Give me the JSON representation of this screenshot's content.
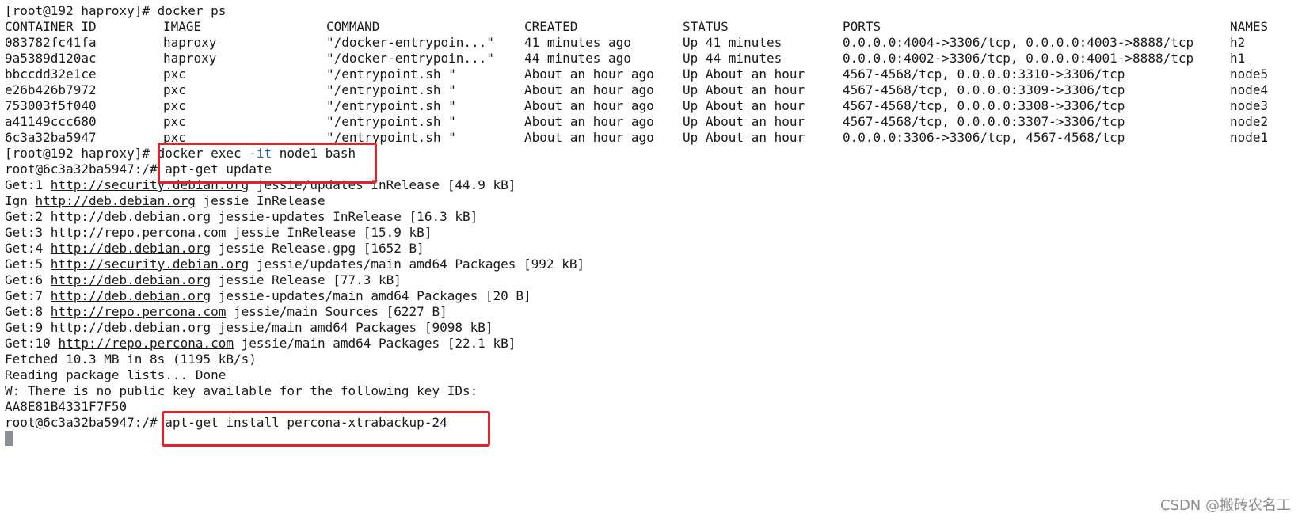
{
  "ps": {
    "prompt": "[root@192 haproxy]# ",
    "command": "docker ps",
    "headers": {
      "container_id": "CONTAINER ID",
      "image": "IMAGE",
      "command": "COMMAND",
      "created": "CREATED",
      "status": "STATUS",
      "ports": "PORTS",
      "names": "NAMES"
    },
    "rows": [
      {
        "id": "083782fc41fa",
        "image": "haproxy",
        "command": "\"/docker-entrypoin...\"",
        "created": "41 minutes ago",
        "status": "Up 41 minutes",
        "ports": "0.0.0.0:4004->3306/tcp, 0.0.0.0:4003->8888/tcp",
        "name": "h2"
      },
      {
        "id": "9a5389d120ac",
        "image": "haproxy",
        "command": "\"/docker-entrypoin...\"",
        "created": "44 minutes ago",
        "status": "Up 44 minutes",
        "ports": "0.0.0.0:4002->3306/tcp, 0.0.0.0:4001->8888/tcp",
        "name": "h1"
      },
      {
        "id": "bbccdd32e1ce",
        "image": "pxc",
        "command": "\"/entrypoint.sh \"",
        "created": "About an hour ago",
        "status": "Up About an hour",
        "ports": "4567-4568/tcp, 0.0.0.0:3310->3306/tcp",
        "name": "node5"
      },
      {
        "id": "e26b426b7972",
        "image": "pxc",
        "command": "\"/entrypoint.sh \"",
        "created": "About an hour ago",
        "status": "Up About an hour",
        "ports": "4567-4568/tcp, 0.0.0.0:3309->3306/tcp",
        "name": "node4"
      },
      {
        "id": "753003f5f040",
        "image": "pxc",
        "command": "\"/entrypoint.sh \"",
        "created": "About an hour ago",
        "status": "Up About an hour",
        "ports": "4567-4568/tcp, 0.0.0.0:3308->3306/tcp",
        "name": "node3"
      },
      {
        "id": "a41149ccc680",
        "image": "pxc",
        "command": "\"/entrypoint.sh \"",
        "created": "About an hour ago",
        "status": "Up About an hour",
        "ports": "4567-4568/tcp, 0.0.0.0:3307->3306/tcp",
        "name": "node2"
      },
      {
        "id": "6c3a32ba5947",
        "image": "pxc",
        "command": "\"/entrypoint.sh \"",
        "created": "About an hour ago",
        "status": "Up About an hour",
        "ports": "0.0.0.0:3306->3306/tcp, 4567-4568/tcp",
        "name": "node1"
      }
    ]
  },
  "exec": {
    "prompt": "[root@192 haproxy]# ",
    "cmd_start": "docker exec ",
    "flag": "-it",
    "cmd_end": " node1 bash"
  },
  "update": {
    "prompt": "root@6c3a32ba5947:/# ",
    "command": "apt-get update"
  },
  "apt_lines": [
    {
      "prefix": "Get:1 ",
      "url": "http://security.debian.org",
      "suffix": " jessie/updates InRelease [44.9 kB]"
    },
    {
      "prefix": "Ign ",
      "url": "http://deb.debian.org",
      "suffix": " jessie InRelease"
    },
    {
      "prefix": "Get:2 ",
      "url": "http://deb.debian.org",
      "suffix": " jessie-updates InRelease [16.3 kB]"
    },
    {
      "prefix": "Get:3 ",
      "url": "http://repo.percona.com",
      "suffix": " jessie InRelease [15.9 kB]"
    },
    {
      "prefix": "Get:4 ",
      "url": "http://deb.debian.org",
      "suffix": " jessie Release.gpg [1652 B]"
    },
    {
      "prefix": "Get:5 ",
      "url": "http://security.debian.org",
      "suffix": " jessie/updates/main amd64 Packages [992 kB]"
    },
    {
      "prefix": "Get:6 ",
      "url": "http://deb.debian.org",
      "suffix": " jessie Release [77.3 kB]"
    },
    {
      "prefix": "Get:7 ",
      "url": "http://deb.debian.org",
      "suffix": " jessie-updates/main amd64 Packages [20 B]"
    },
    {
      "prefix": "Get:8 ",
      "url": "http://repo.percona.com",
      "suffix": " jessie/main Sources [6227 B]"
    },
    {
      "prefix": "Get:9 ",
      "url": "http://deb.debian.org",
      "suffix": " jessie/main amd64 Packages [9098 kB]"
    },
    {
      "prefix": "Get:10 ",
      "url": "http://repo.percona.com",
      "suffix": " jessie/main amd64 Packages [22.1 kB]"
    }
  ],
  "output_lines": [
    "Fetched 10.3 MB in 8s (1195 kB/s)",
    "Reading package lists... Done",
    "W: There is no public key available for the following key IDs:",
    "AA8E81B4331F7F50"
  ],
  "install": {
    "prompt": "root@6c3a32ba5947:/# ",
    "command": "apt-get install percona-xtrabackup-24"
  },
  "watermark": "CSDN @搬砖农名工",
  "colors": {
    "highlight_box": "#e0222a",
    "flag": "#2a56c6",
    "cursor": "#8a8f9a"
  }
}
